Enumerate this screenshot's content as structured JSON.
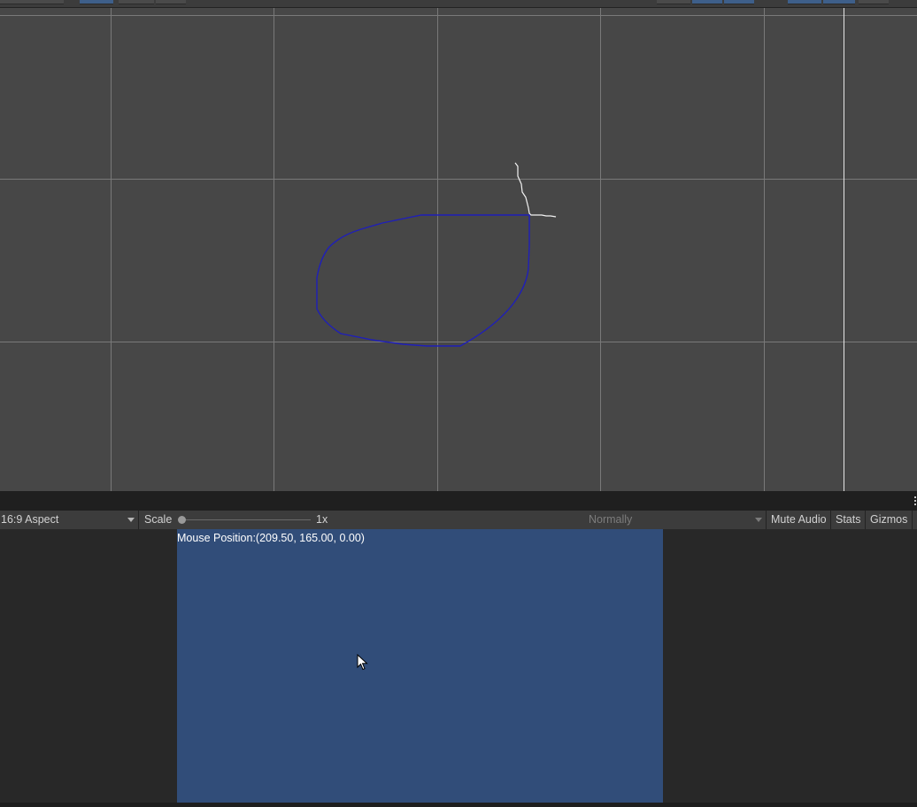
{
  "scene": {
    "background_color": "#474747",
    "grid_color": "#8a8a8a",
    "outline_color": "#1f1fb8",
    "gizmo_color": "#ffffff"
  },
  "game_toolbar": {
    "aspect_label": "16:9 Aspect",
    "scale_label": "Scale",
    "scale_value": "1x",
    "scale_slider_fraction": 0.0,
    "play_mode_label": "Normally",
    "mute_audio_label": "Mute Audio",
    "stats_label": "Stats",
    "gizmos_label": "Gizmos"
  },
  "game_view": {
    "background_color": "#314d79",
    "mouse_position_text": "Mouse Position:(209.50, 165.00, 0.00)",
    "cursor_icon": "arrow-cursor-icon"
  }
}
